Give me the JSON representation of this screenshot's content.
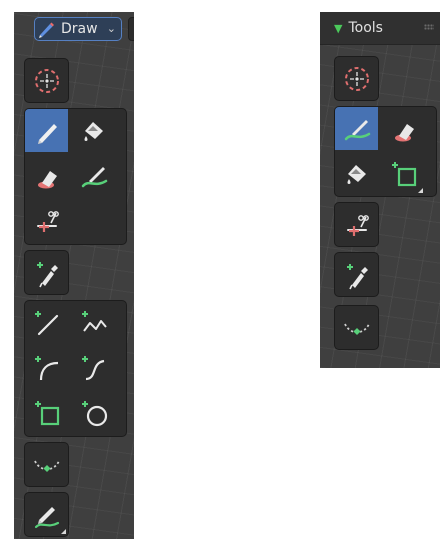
{
  "left_panel": {
    "mode_select": {
      "icon": "pencil-icon",
      "label": "Draw",
      "chevron": "⌄"
    },
    "tools": [
      "select-circle",
      "draw",
      "fill",
      "erase",
      "tint",
      "cutter",
      "eyedropper",
      "line",
      "polyline",
      "arc",
      "curve",
      "box",
      "circle",
      "interpolate",
      "annotate"
    ]
  },
  "right_panel": {
    "header": {
      "title": "Tools",
      "collapse_icon": "triangle-down-icon"
    },
    "tools": [
      "select-circle",
      "draw",
      "erase",
      "fill",
      "box",
      "cutter",
      "eyedropper",
      "interpolate"
    ]
  },
  "colors": {
    "active": "#4772b3",
    "accent_green": "#4bc95b",
    "eraser_red": "#e37373",
    "select_dash": "#e06f6f"
  }
}
